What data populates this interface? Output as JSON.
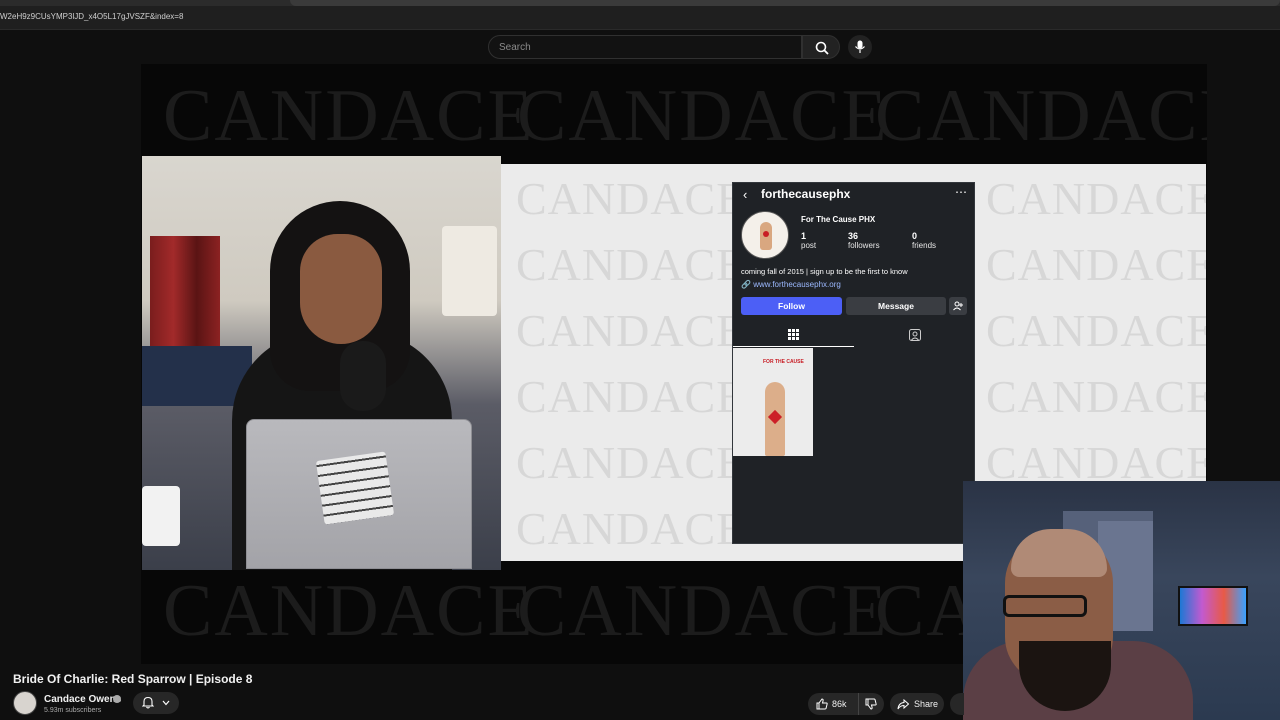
{
  "browser": {
    "url": "W2eH9z9CUsYMP3lJD_x4O5L17gJVSZF&index=8"
  },
  "search": {
    "placeholder": "Search"
  },
  "video": {
    "watermark": "CANDACE",
    "overlay_profile": {
      "handle": "forthecausephx",
      "display_name": "For The Cause PHX",
      "stats": [
        {
          "value": "1",
          "label": "post"
        },
        {
          "value": "36",
          "label": "followers"
        },
        {
          "value": "0",
          "label": "friends"
        }
      ],
      "bio": "coming fall of 2015 | sign up to be the first to know",
      "link": "www.forthecausephx.org",
      "follow_label": "Follow",
      "message_label": "Message",
      "post_logo_text": "FOR THE CAUSE"
    }
  },
  "info": {
    "title": "Bride Of Charlie: Red Sparrow | Episode 8",
    "channel": "Candace Owens",
    "subscribers": "5.93m subscribers",
    "likes": "86k",
    "share_label": "Share"
  }
}
